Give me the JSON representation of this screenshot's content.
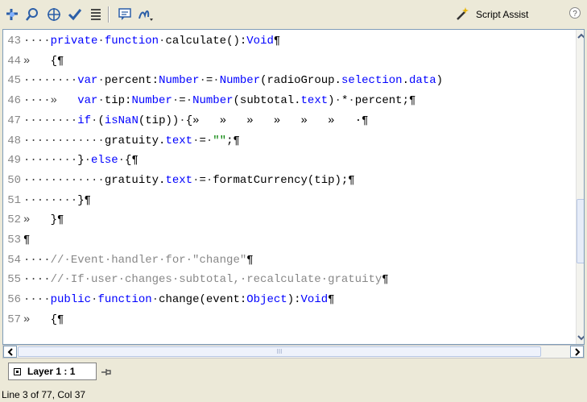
{
  "toolbar": {
    "icons": [
      "add-statement-icon",
      "find-replace-icon",
      "insert-target-path-icon",
      "check-syntax-icon",
      "auto-format-icon",
      "show-code-hint-icon",
      "debug-options-icon"
    ],
    "script_assist_label": "Script Assist",
    "help_icon": "help-icon"
  },
  "editor": {
    "lines": [
      {
        "num": "43",
        "parts": [
          [
            "dot",
            "····"
          ],
          [
            "kw",
            "private"
          ],
          [
            "dot",
            "·"
          ],
          [
            "kw",
            "function"
          ],
          [
            "dot",
            "·"
          ],
          [
            "code",
            "calculate():"
          ],
          [
            "ty",
            "Void"
          ],
          [
            "code",
            "¶"
          ]
        ]
      },
      {
        "num": "44",
        "parts": [
          [
            "dot",
            "»   "
          ],
          [
            "code",
            "{¶"
          ]
        ]
      },
      {
        "num": "45",
        "parts": [
          [
            "dot",
            "········"
          ],
          [
            "kw",
            "var"
          ],
          [
            "dot",
            "·"
          ],
          [
            "code",
            "percent:"
          ],
          [
            "ty",
            "Number"
          ],
          [
            "dot",
            "·"
          ],
          [
            "code",
            "="
          ],
          [
            "dot",
            "·"
          ],
          [
            "ty",
            "Number"
          ],
          [
            "code",
            "(radioGroup."
          ],
          [
            "ty",
            "selection"
          ],
          [
            "code",
            "."
          ],
          [
            "ty",
            "data"
          ],
          [
            "code",
            ")"
          ]
        ]
      },
      {
        "num": "46",
        "parts": [
          [
            "dot",
            "····»   "
          ],
          [
            "kw",
            "var"
          ],
          [
            "dot",
            "·"
          ],
          [
            "code",
            "tip:"
          ],
          [
            "ty",
            "Number"
          ],
          [
            "dot",
            "·"
          ],
          [
            "code",
            "="
          ],
          [
            "dot",
            "·"
          ],
          [
            "ty",
            "Number"
          ],
          [
            "code",
            "(subtotal."
          ],
          [
            "ty",
            "text"
          ],
          [
            "code",
            ")"
          ],
          [
            "dot",
            "·"
          ],
          [
            "code",
            "*"
          ],
          [
            "dot",
            "·"
          ],
          [
            "code",
            "percent;¶"
          ]
        ]
      },
      {
        "num": "47",
        "parts": [
          [
            "dot",
            "········"
          ],
          [
            "kw",
            "if"
          ],
          [
            "dot",
            "·"
          ],
          [
            "code",
            "("
          ],
          [
            "ty",
            "isNaN"
          ],
          [
            "code",
            "(tip))"
          ],
          [
            "dot",
            "·"
          ],
          [
            "code",
            "{»   »   »   »   »   »   ·¶"
          ]
        ]
      },
      {
        "num": "48",
        "parts": [
          [
            "dot",
            "············"
          ],
          [
            "code",
            "gratuity."
          ],
          [
            "ty",
            "text"
          ],
          [
            "dot",
            "·"
          ],
          [
            "code",
            "="
          ],
          [
            "dot",
            "·"
          ],
          [
            "st",
            "\"\""
          ],
          [
            "code",
            ";¶"
          ]
        ]
      },
      {
        "num": "49",
        "parts": [
          [
            "dot",
            "········"
          ],
          [
            "code",
            "}"
          ],
          [
            "dot",
            "·"
          ],
          [
            "kw",
            "else"
          ],
          [
            "dot",
            "·"
          ],
          [
            "code",
            "{¶"
          ]
        ]
      },
      {
        "num": "50",
        "parts": [
          [
            "dot",
            "············"
          ],
          [
            "code",
            "gratuity."
          ],
          [
            "ty",
            "text"
          ],
          [
            "dot",
            "·"
          ],
          [
            "code",
            "="
          ],
          [
            "dot",
            "·"
          ],
          [
            "code",
            "formatCurrency(tip);¶"
          ]
        ]
      },
      {
        "num": "51",
        "parts": [
          [
            "dot",
            "········"
          ],
          [
            "code",
            "}¶"
          ]
        ]
      },
      {
        "num": "52",
        "parts": [
          [
            "dot",
            "»   "
          ],
          [
            "code",
            "}¶"
          ]
        ]
      },
      {
        "num": "53",
        "parts": [
          [
            "code",
            "¶"
          ]
        ]
      },
      {
        "num": "54",
        "parts": [
          [
            "dot",
            "····"
          ],
          [
            "cm",
            "//·Event·handler·for·\"change\""
          ],
          [
            "code",
            "¶"
          ]
        ]
      },
      {
        "num": "55",
        "parts": [
          [
            "dot",
            "····"
          ],
          [
            "cm",
            "//·If·user·changes·subtotal,·recalculate·gratuity"
          ],
          [
            "code",
            "¶"
          ]
        ]
      },
      {
        "num": "56",
        "parts": [
          [
            "dot",
            "····"
          ],
          [
            "kw",
            "public"
          ],
          [
            "dot",
            "·"
          ],
          [
            "kw",
            "function"
          ],
          [
            "dot",
            "·"
          ],
          [
            "code",
            "change(event:"
          ],
          [
            "ty",
            "Object"
          ],
          [
            "code",
            "):"
          ],
          [
            "ty",
            "Void"
          ],
          [
            "code",
            "¶"
          ]
        ]
      },
      {
        "num": "57",
        "parts": [
          [
            "dot",
            "»   "
          ],
          [
            "code",
            "{¶"
          ]
        ]
      }
    ],
    "hscroll_thumb_mark": "III"
  },
  "tab": {
    "label": "Layer 1 : 1"
  },
  "status": {
    "text": "Line 3 of 77, Col 37"
  }
}
